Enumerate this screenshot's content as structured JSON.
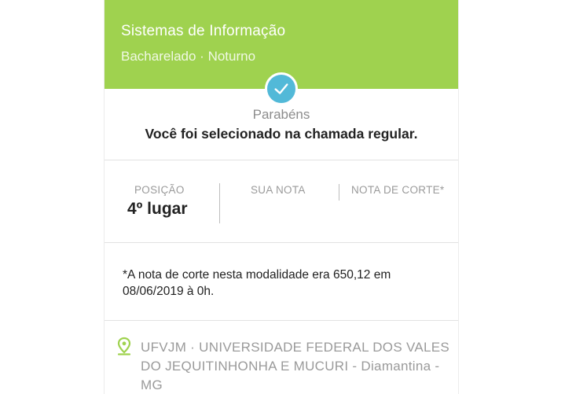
{
  "header": {
    "course_name": "Sistemas de Informação",
    "course_degree": "Bacharelado · Noturno",
    "background_color": "#9fd24f"
  },
  "result": {
    "icon": "check-icon",
    "badge_color": "#52b9d8",
    "congrats": "Parabéns",
    "message": "Você foi selecionado na chamada regular."
  },
  "stats": {
    "position_label": "POSIÇÃO",
    "position_value": "4º lugar",
    "score_label": "SUA NOTA",
    "score_value": "",
    "cutoff_label": "NOTA DE CORTE*",
    "cutoff_value": ""
  },
  "note": "*A nota de corte nesta modalidade era 650,12 em 08/06/2019 à 0h.",
  "location": {
    "icon": "map-pin-icon",
    "icon_color": "#9fd24f",
    "text": "UFVJM · UNIVERSIDADE FEDERAL DOS VALES DO JEQUITINHONHA E MUCURI - Diamantina - MG"
  }
}
